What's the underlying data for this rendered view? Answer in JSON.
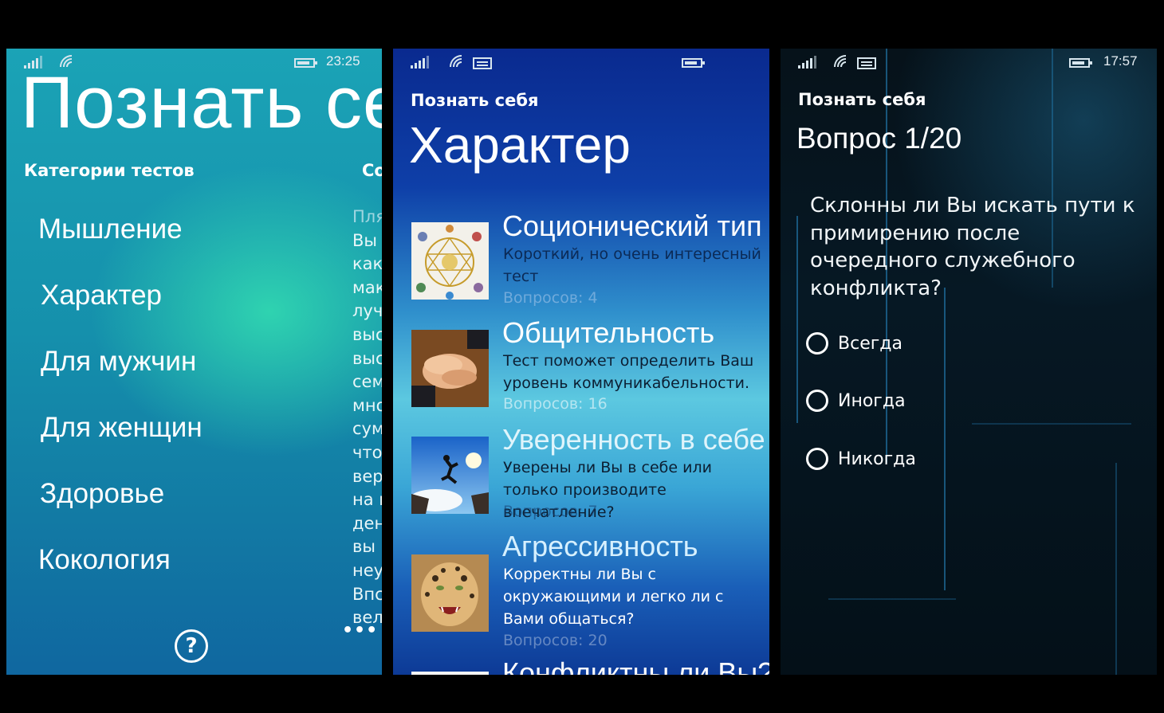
{
  "screen1": {
    "status": {
      "time": "23:25"
    },
    "title": "Познать себя",
    "section_label": "Категории тестов",
    "next_section_label": "Со",
    "categories": [
      "Мышление",
      "Характер",
      "Для мужчин",
      "Для женщин",
      "Здоровье",
      "Кокология"
    ],
    "peek_lines": [
      "Пля",
      "Вы",
      "как",
      "мак",
      "луч",
      "выс",
      "выс",
      "сем",
      "мно",
      "сум",
      "что",
      "вер",
      "на в",
      "ден",
      "вы",
      "неу",
      "Впс",
      "вел"
    ],
    "help_icon": "?",
    "more_icon": "•••"
  },
  "screen2": {
    "app_title": "Познать себя",
    "page_title": "Характер",
    "tests": [
      {
        "title": "Соционический тип",
        "description": "Короткий, но очень интересный тест",
        "questions": "Вопросов: 4",
        "thumb": "socionics-diagram"
      },
      {
        "title": "Общительность",
        "description": "Тест поможет определить Ваш уровень коммуникабельности.",
        "questions": "Вопросов: 16",
        "thumb": "hands-together"
      },
      {
        "title": "Уверенность в себе",
        "description": "Уверены ли Вы в себе или только производите впечатление?",
        "questions": "Вопросов: 7",
        "thumb": "jump-between-cliffs"
      },
      {
        "title": "Агрессивность",
        "description": "Корректны ли Вы с окружающими и легко ли с Вами общаться?",
        "questions": "Вопросов: 20",
        "thumb": "leopard"
      },
      {
        "title": "Конфликтны ли Вы?",
        "description": "",
        "questions": "",
        "thumb": ""
      }
    ]
  },
  "screen3": {
    "status": {
      "time": "17:57"
    },
    "app_title": "Познать себя",
    "page_title": "Вопрос 1/20",
    "question": "Склонны ли Вы искать пути к примирению после очередного служебного конфликта?",
    "options": [
      "Всегда",
      "Иногда",
      "Никогда"
    ]
  }
}
